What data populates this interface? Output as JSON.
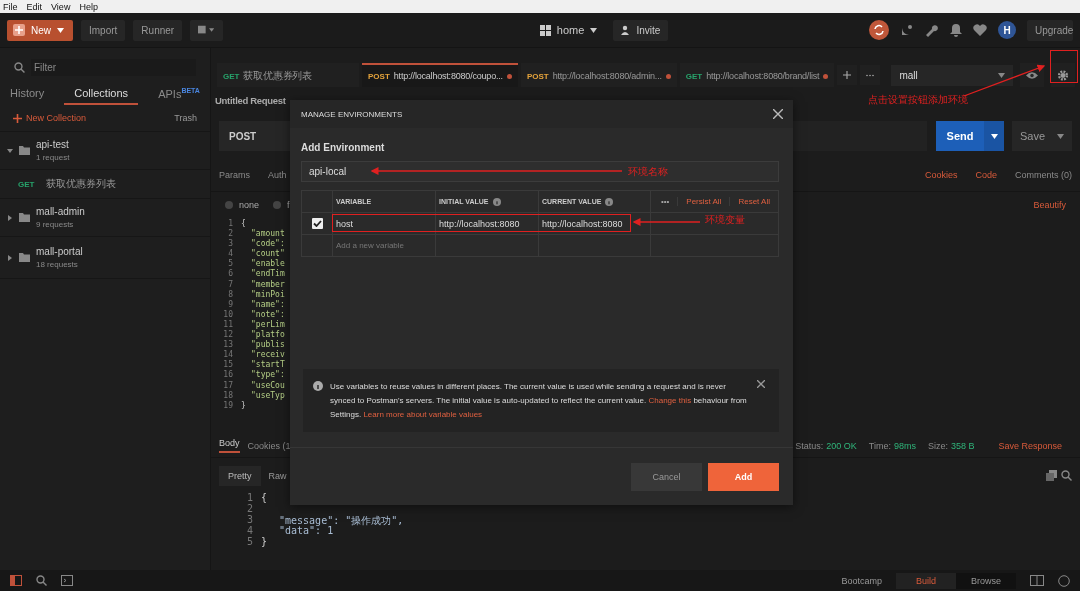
{
  "menu_bar": [
    "File",
    "Edit",
    "View",
    "Help"
  ],
  "header": {
    "new_button": "New",
    "import_button": "Import",
    "runner_button": "Runner",
    "workspace": "home",
    "invite_button": "Invite",
    "avatar_initial": "H",
    "upgrade_button": "Upgrade"
  },
  "sidebar": {
    "filter_placeholder": "Filter",
    "tabs": [
      {
        "label": "History",
        "selected": false
      },
      {
        "label": "Collections",
        "selected": true
      },
      {
        "label": "APIs",
        "badge": "BETA",
        "selected": false
      }
    ],
    "new_collection": "New Collection",
    "trash": "Trash",
    "collections": [
      {
        "name": "api-test",
        "count": "1 request",
        "expanded": true,
        "children": [
          {
            "method": "GET",
            "color": "#27a36b",
            "name": "获取优惠券列表"
          }
        ]
      },
      {
        "name": "mall-admin",
        "count": "9 requests",
        "expanded": false
      },
      {
        "name": "mall-portal",
        "count": "18 requests",
        "expanded": false
      }
    ]
  },
  "request_tabs": [
    {
      "method": "GET",
      "color": "#27a36b",
      "kind": "named",
      "title": "获取优惠券列表",
      "selected": false,
      "unsaved": false
    },
    {
      "method": "POST",
      "color": "#e5a33b",
      "kind": "url",
      "title": "http://localhost:8080/coupo...",
      "selected": true,
      "unsaved": true
    },
    {
      "method": "POST",
      "color": "#e5a33b",
      "kind": "url",
      "title": "http://localhost:8080/admin...",
      "selected": false,
      "unsaved": true
    },
    {
      "method": "GET",
      "color": "#27a36b",
      "kind": "url",
      "title": "http://localhost:8080/brand/list",
      "selected": false,
      "unsaved": true
    }
  ],
  "environment": {
    "selected": "mall"
  },
  "request": {
    "title": "Untitled Request",
    "method": "POST",
    "send": "Send",
    "save": "Save",
    "subtabs": [
      "Params",
      "Auth"
    ],
    "links": [
      "Cookies",
      "Code",
      "Comments (0)"
    ],
    "body_modes": [
      {
        "label": "none",
        "selected": false
      },
      {
        "label": "f",
        "selected": false
      }
    ],
    "beautify": "Beautify",
    "body_lines": [
      {
        "n": "1",
        "text": "{",
        "kind": "brace"
      },
      {
        "n": "2",
        "text": "\"amount",
        "kind": "key"
      },
      {
        "n": "3",
        "text": "\"code\":",
        "kind": "key"
      },
      {
        "n": "4",
        "text": "\"count\"",
        "kind": "key"
      },
      {
        "n": "5",
        "text": "\"enable",
        "kind": "key"
      },
      {
        "n": "6",
        "text": "\"endTim",
        "kind": "key"
      },
      {
        "n": "7",
        "text": "\"member",
        "kind": "key"
      },
      {
        "n": "8",
        "text": "\"minPoi",
        "kind": "key"
      },
      {
        "n": "9",
        "text": "\"name\":",
        "kind": "key"
      },
      {
        "n": "10",
        "text": "\"note\":",
        "kind": "key"
      },
      {
        "n": "11",
        "text": "\"perLim",
        "kind": "key"
      },
      {
        "n": "12",
        "text": "\"platfo",
        "kind": "key"
      },
      {
        "n": "13",
        "text": "\"publis",
        "kind": "key"
      },
      {
        "n": "14",
        "text": "\"receiv",
        "kind": "key"
      },
      {
        "n": "15",
        "text": "\"startT",
        "kind": "key"
      },
      {
        "n": "16",
        "text": "\"type\":",
        "kind": "key"
      },
      {
        "n": "17",
        "text": "\"useCou",
        "kind": "key"
      },
      {
        "n": "18",
        "text": "\"useTyp",
        "kind": "key"
      },
      {
        "n": "19",
        "text": "}",
        "kind": "brace"
      }
    ]
  },
  "response": {
    "tabs": [
      {
        "label": "Body",
        "selected": true
      },
      {
        "label": "Cookies (1",
        "selected": false
      }
    ],
    "status_label": "Status:",
    "status": "200 OK",
    "time_label": "Time:",
    "time": "98ms",
    "size_label": "Size:",
    "size": "358 B",
    "save_response": "Save Response",
    "views": [
      {
        "label": "Pretty",
        "selected": true
      },
      {
        "label": "Raw",
        "selected": false
      }
    ],
    "lines": [
      {
        "n": "1",
        "text": "{",
        "kind": "brace"
      },
      {
        "n": "2"
      },
      {
        "n": "3",
        "text": "\"message\": \"操作成功\",",
        "kind": "key"
      },
      {
        "n": "4",
        "text": "\"data\": 1",
        "kind": "key"
      },
      {
        "n": "5",
        "text": "}",
        "kind": "brace"
      }
    ]
  },
  "status_bar": {
    "bootcamp": "Bootcamp",
    "modes": [
      {
        "label": "Build",
        "selected": true
      },
      {
        "label": "Browse",
        "selected": false
      }
    ]
  },
  "modal": {
    "title": "MANAGE ENVIRONMENTS",
    "heading": "Add Environment",
    "name_value": "api-local",
    "columns": [
      {
        "label": "VARIABLE",
        "kind": "plain"
      },
      {
        "label": "INITIAL VALUE",
        "kind": "info"
      },
      {
        "label": "CURRENT VALUE",
        "kind": "info"
      }
    ],
    "more": "•••",
    "actions": [
      "Persist All",
      "Reset All"
    ],
    "variables": [
      {
        "enabled": true,
        "name": "host",
        "initial": "http://localhost:8080",
        "current": "http://localhost:8080"
      }
    ],
    "new_variable_placeholder": "Add a new variable",
    "info": [
      {
        "kind": "plain",
        "text": "Use variables to reuse values in different places. The current value is used while sending a request and is never synced to Postman's servers. The initial value is auto-updated to reflect the current value."
      },
      {
        "kind": "link",
        "text": "Change this"
      },
      {
        "kind": "plain",
        "text": "behaviour from Settings."
      },
      {
        "kind": "link",
        "text": "Learn more about variable values"
      }
    ],
    "cancel": "Cancel",
    "add": "Add"
  },
  "annotations": [
    {
      "kind": "settings",
      "text": "点击设置按钮添加环境"
    },
    {
      "kind": "name",
      "text": "环境名称"
    },
    {
      "kind": "variable",
      "text": "环境变量"
    }
  ]
}
